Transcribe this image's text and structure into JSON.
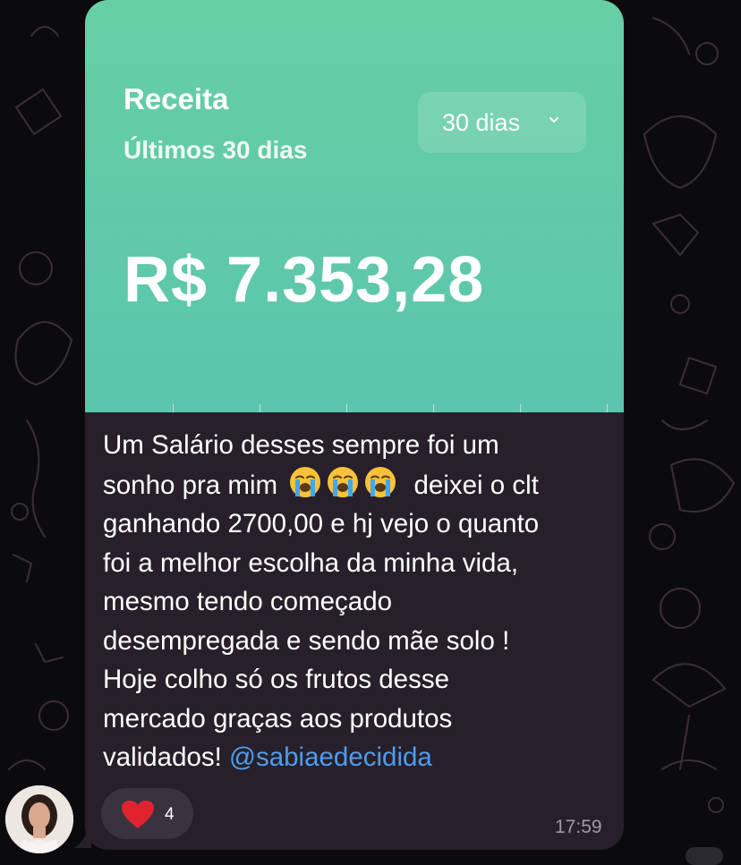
{
  "colors": {
    "background": "#0b0b0d",
    "card_gradient_top": "#66cfa3",
    "card_gradient_bottom": "#5bc5ad",
    "bubble": "#27202a",
    "mention": "#4e9cf0",
    "heart": "#e0242f"
  },
  "card": {
    "title": "Receita",
    "subtitle": "Últimos 30 dias",
    "amount": "R$ 7.353,28",
    "period_selector": "30 dias"
  },
  "message": {
    "line1": "Um Salário desses sempre foi um",
    "line2_before": "sonho pra mim",
    "line2_emojis": [
      "loudly-crying-face",
      "loudly-crying-face",
      "loudly-crying-face"
    ],
    "line2_after": "deixei o clt",
    "line3": "ganhando 2700,00 e hj vejo o quanto",
    "line4": "foi a melhor escolha da minha vida,",
    "line5": "mesmo tendo começado",
    "line6": "desempregada e sendo mãe solo !",
    "line7": "Hoje colho só os frutos desse",
    "line8": "mercado graças aos produtos",
    "line9_before": "validados!",
    "mention": "@sabiaedecidida"
  },
  "reaction": {
    "icon": "heart-icon",
    "count": "4"
  },
  "timestamp": "17:59",
  "sender": {
    "avatar": "avatar"
  }
}
